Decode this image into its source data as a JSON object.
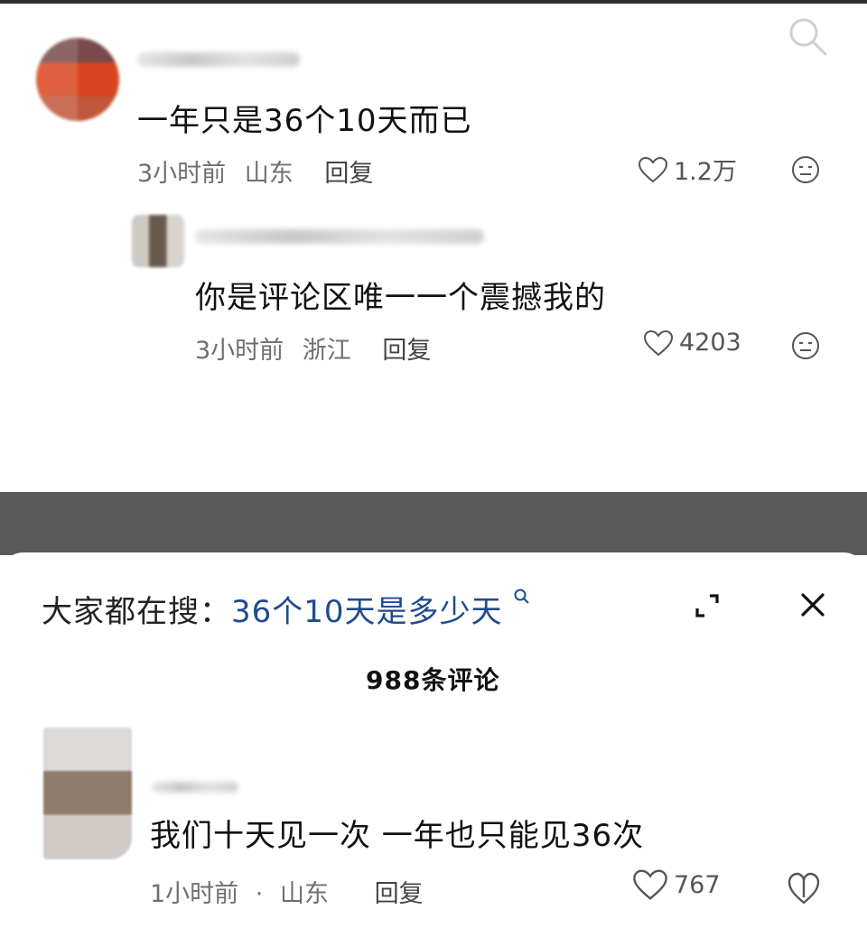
{
  "top_panel": {
    "comment1": {
      "text": "一年只是36个10天而已",
      "time": "3小时前",
      "location": "山东",
      "reply_label": "回复",
      "likes": "1.2万"
    },
    "reply1": {
      "text": "你是评论区唯一一个震撼我的",
      "time": "3小时前",
      "location": "浙江",
      "reply_label": "回复",
      "likes": "4203"
    }
  },
  "bottom_panel": {
    "search_prefix": "大家都在搜：",
    "search_term": "36个10天是多少天",
    "comment_count": "988条评论",
    "comment1": {
      "text": "我们十天见一次 一年也只能见36次",
      "time": "1小时前",
      "separator": "·",
      "location": "山东",
      "reply_label": "回复",
      "likes": "767"
    }
  },
  "colors": {
    "search_term": "#1f4b8f",
    "gap": "#595959",
    "meta_text": "#6f6f6f"
  },
  "icons": [
    "search-icon",
    "heart-icon",
    "emoji-icon",
    "expand-icon",
    "close-icon",
    "dislike-icon"
  ]
}
